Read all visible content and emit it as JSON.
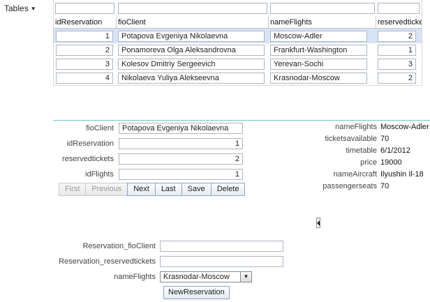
{
  "menu": {
    "tables_label": "Tables",
    "arrow": "▼"
  },
  "grid": {
    "columns": [
      "idReservation",
      "fioClient",
      "nameFlights",
      "reservedtickets"
    ],
    "rows": [
      {
        "idReservation": "1",
        "fioClient": "Potapova Evgeniya Nikolaevna",
        "nameFlights": "Moscow-Adler",
        "reservedtickets": "2"
      },
      {
        "idReservation": "2",
        "fioClient": "Ponamoreva Olga Aleksandrovna",
        "nameFlights": "Frankfurt-Washington",
        "reservedtickets": "1"
      },
      {
        "idReservation": "3",
        "fioClient": "Kolesov Dmitriy Sergeevich",
        "nameFlights": "Yerevan-Sochi",
        "reservedtickets": "3"
      },
      {
        "idReservation": "4",
        "fioClient": "Nikolaeva Yuliya Alekseevna",
        "nameFlights": "Krasnodar-Moscow",
        "reservedtickets": "2"
      }
    ]
  },
  "form": {
    "fioClient": {
      "label": "fioClient",
      "value": "Potapova Evgeniya Nikolaevna"
    },
    "idReservation": {
      "label": "idReservation",
      "value": "1"
    },
    "reservedtickets": {
      "label": "reservedtickets",
      "value": "2"
    },
    "idFlights": {
      "label": "idFlights",
      "value": "1"
    }
  },
  "nav": {
    "first": "First",
    "previous": "Previous",
    "next": "Next",
    "last": "Last",
    "save": "Save",
    "delete": "Delete"
  },
  "details": [
    {
      "label": "nameFlights",
      "value": "Moscow-Adler"
    },
    {
      "label": "ticketsavailable",
      "value": "70"
    },
    {
      "label": "timetable",
      "value": "6/1/2012"
    },
    {
      "label": "price",
      "value": "19000"
    },
    {
      "label": "nameAircraft",
      "value": "Ilyushin Il-18"
    },
    {
      "label": "passengerseats",
      "value": "70"
    }
  ],
  "new_reservation": {
    "fioClient_label": "Reservation_fioClient",
    "fioClient_value": "",
    "reservedtickets_label": "Reservation_reservedtickets",
    "reservedtickets_value": "",
    "nameFlights_label": "nameFlights",
    "nameFlights_value": "Krasnodar-Moscow",
    "button_label": "NewReservation"
  }
}
